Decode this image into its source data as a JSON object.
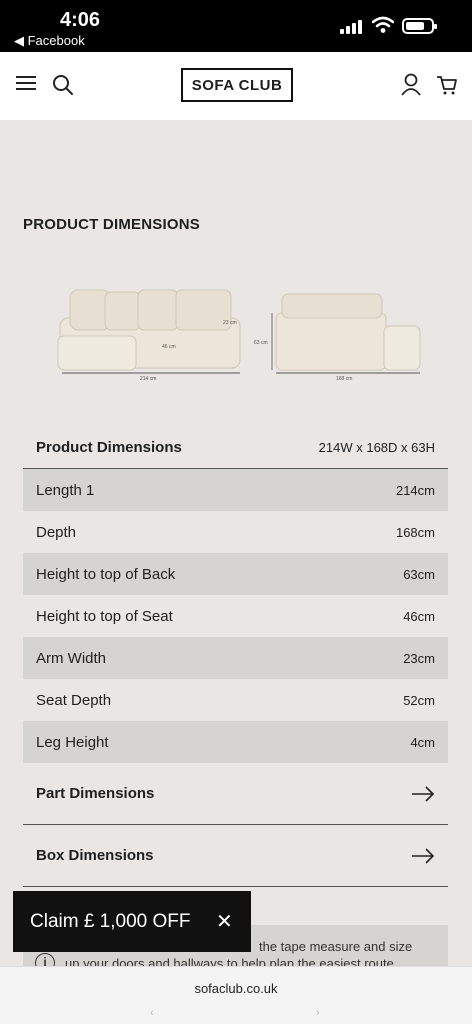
{
  "status": {
    "time": "4:06",
    "back_label": "◀ Facebook"
  },
  "header": {
    "logo": "SOFA CLUB"
  },
  "section": {
    "title": "PRODUCT DIMENSIONS"
  },
  "image_labels": {
    "seat_height": "46 cm",
    "arm_width": "23 cm",
    "back_height": "63 cm",
    "length": "214 cm",
    "depth": "168 cm"
  },
  "table": {
    "head_label": "Product Dimensions",
    "head_value": "214W x 168D x 63H",
    "rows": [
      {
        "label": "Length 1",
        "value": "214cm"
      },
      {
        "label": "Depth",
        "value": "168cm"
      },
      {
        "label": "Height to top of Back",
        "value": "63cm"
      },
      {
        "label": "Height to top of Seat",
        "value": "46cm"
      },
      {
        "label": "Arm Width",
        "value": "23cm"
      },
      {
        "label": "Seat Depth",
        "value": "52cm"
      },
      {
        "label": "Leg Height",
        "value": "4cm"
      }
    ],
    "links": [
      {
        "label": "Part Dimensions"
      },
      {
        "label": "Box Dimensions"
      }
    ]
  },
  "info": {
    "line1": "the tape measure and size",
    "line2": "up your doors and hallways to help plan the easiest route"
  },
  "promo": {
    "label": "Claim £ 1,000 OFF",
    "close": "✕"
  },
  "browser": {
    "url": "sofaclub.co.uk"
  }
}
